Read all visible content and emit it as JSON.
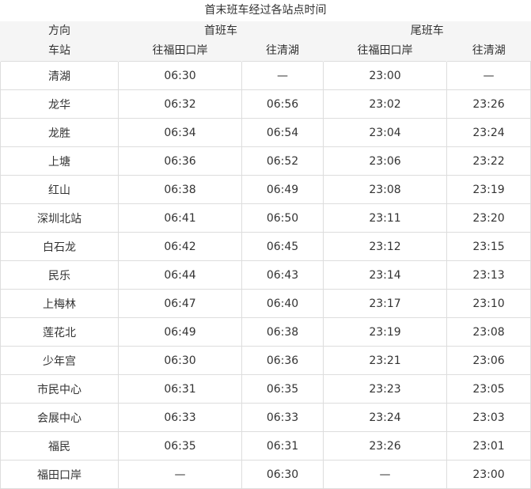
{
  "caption": "首末班车经过各站点时间",
  "header": {
    "direction_label": "方向",
    "station_label": "车站",
    "first_train_label": "首班车",
    "last_train_label": "尾班车",
    "to_futian": "往福田口岸",
    "to_qinghu": "往清湖",
    "to_futian_2": "往福田口岸",
    "to_qinghu_2": "往清湖"
  },
  "rows": [
    {
      "station": "清湖",
      "first_futian": "06:30",
      "first_qinghu": "—",
      "last_futian": "23:00",
      "last_qinghu": "—"
    },
    {
      "station": "龙华",
      "first_futian": "06:32",
      "first_qinghu": "06:56",
      "last_futian": "23:02",
      "last_qinghu": "23:26"
    },
    {
      "station": "龙胜",
      "first_futian": "06:34",
      "first_qinghu": "06:54",
      "last_futian": "23:04",
      "last_qinghu": "23:24"
    },
    {
      "station": "上塘",
      "first_futian": "06:36",
      "first_qinghu": "06:52",
      "last_futian": "23:06",
      "last_qinghu": "23:22"
    },
    {
      "station": "红山",
      "first_futian": "06:38",
      "first_qinghu": "06:49",
      "last_futian": "23:08",
      "last_qinghu": "23:19"
    },
    {
      "station": "深圳北站",
      "first_futian": "06:41",
      "first_qinghu": "06:50",
      "last_futian": "23:11",
      "last_qinghu": "23:20"
    },
    {
      "station": "白石龙",
      "first_futian": "06:42",
      "first_qinghu": "06:45",
      "last_futian": "23:12",
      "last_qinghu": "23:15"
    },
    {
      "station": "民乐",
      "first_futian": "06:44",
      "first_qinghu": "06:43",
      "last_futian": "23:14",
      "last_qinghu": "23:13"
    },
    {
      "station": "上梅林",
      "first_futian": "06:47",
      "first_qinghu": "06:40",
      "last_futian": "23:17",
      "last_qinghu": "23:10"
    },
    {
      "station": "莲花北",
      "first_futian": "06:49",
      "first_qinghu": "06:38",
      "last_futian": "23:19",
      "last_qinghu": "23:08"
    },
    {
      "station": "少年宫",
      "first_futian": "06:30",
      "first_qinghu": "06:36",
      "last_futian": "23:21",
      "last_qinghu": "23:06"
    },
    {
      "station": "市民中心",
      "first_futian": "06:31",
      "first_qinghu": "06:35",
      "last_futian": "23:23",
      "last_qinghu": "23:05"
    },
    {
      "station": "会展中心",
      "first_futian": "06:33",
      "first_qinghu": "06:33",
      "last_futian": "23:24",
      "last_qinghu": "23:03"
    },
    {
      "station": "福民",
      "first_futian": "06:35",
      "first_qinghu": "06:31",
      "last_futian": "23:26",
      "last_qinghu": "23:01"
    },
    {
      "station": "福田口岸",
      "first_futian": "—",
      "first_qinghu": "06:30",
      "last_futian": "—",
      "last_qinghu": "23:00"
    }
  ]
}
